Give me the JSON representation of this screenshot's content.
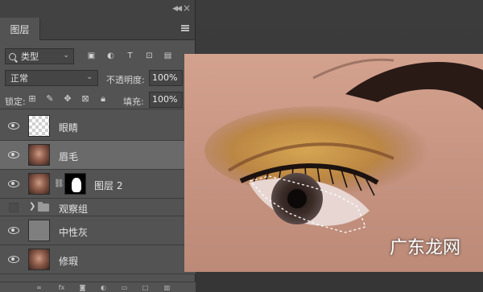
{
  "panel": {
    "tab_label": "图层",
    "filter": {
      "label": "类型",
      "icons": [
        "image-filter-icon",
        "adjustment-filter-icon",
        "type-filter-icon",
        "shape-filter-icon",
        "smart-object-filter-icon"
      ]
    },
    "blend_mode": "正常",
    "opacity_label": "不透明度:",
    "opacity_value": "100%",
    "lock_label": "锁定:",
    "fill_label": "填充:",
    "fill_value": "100%"
  },
  "layers": [
    {
      "name": "眼睛",
      "thumb": "transparent",
      "visible": true,
      "selected": false
    },
    {
      "name": "眉毛",
      "thumb": "portrait",
      "visible": true,
      "selected": true
    },
    {
      "name": "图层 2",
      "thumb": "portrait",
      "has_mask": true,
      "visible": true,
      "selected": false
    },
    {
      "name": "观察组",
      "thumb": "folder",
      "visible": false,
      "selected": false,
      "group": true
    },
    {
      "name": "中性灰",
      "thumb": "gray",
      "visible": true,
      "selected": false
    },
    {
      "name": "修瑕",
      "thumb": "portrait",
      "visible": true,
      "selected": false
    }
  ],
  "watermark": "广东龙网"
}
